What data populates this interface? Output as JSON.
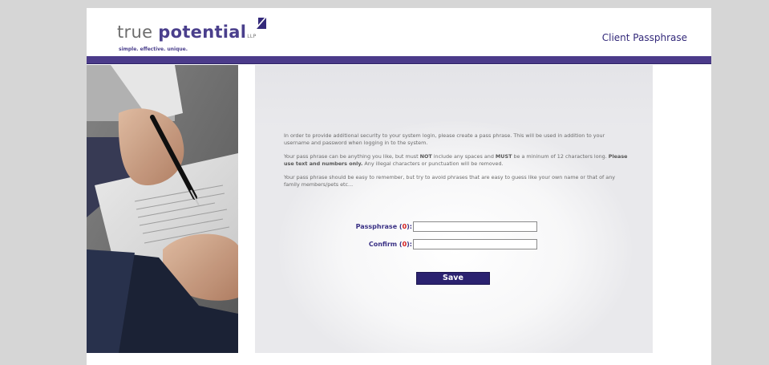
{
  "header": {
    "logo_light": "true ",
    "logo_strong": "potential",
    "logo_llp": "LLP",
    "tagline": "simple. effective. unique.",
    "title": "Client Passphrase"
  },
  "content": {
    "paragraph1": "In order to provide additional security to your system login, please create a pass phrase. This will be used in addition to your username and password when logging in to the system.",
    "paragraph2_a": "Your pass phrase can be anything you like, but must ",
    "paragraph2_not": "NOT",
    "paragraph2_b": " include any spaces and ",
    "paragraph2_must": "MUST",
    "paragraph2_c": " be a mininum of 12 characters long. ",
    "paragraph2_bold": "Please use text and numbers only.",
    "paragraph2_d": " Any illegal characters or punctuation will be removed.",
    "paragraph3": "Your pass phrase should be easy to remember, but try to avoid phrases that are easy to guess like your own name or that of any family members/pets etc..."
  },
  "form": {
    "passphrase_label": "Passphrase (",
    "passphrase_count": "0",
    "passphrase_label_end": "):",
    "passphrase_value": "",
    "confirm_label": "Confirm (",
    "confirm_count": "0",
    "confirm_label_end": "):",
    "confirm_value": "",
    "save_label": "Save"
  },
  "colors": {
    "brand_purple": "#4b3b8a",
    "button_navy": "#2b2270",
    "count_red": "#d21c1c"
  }
}
